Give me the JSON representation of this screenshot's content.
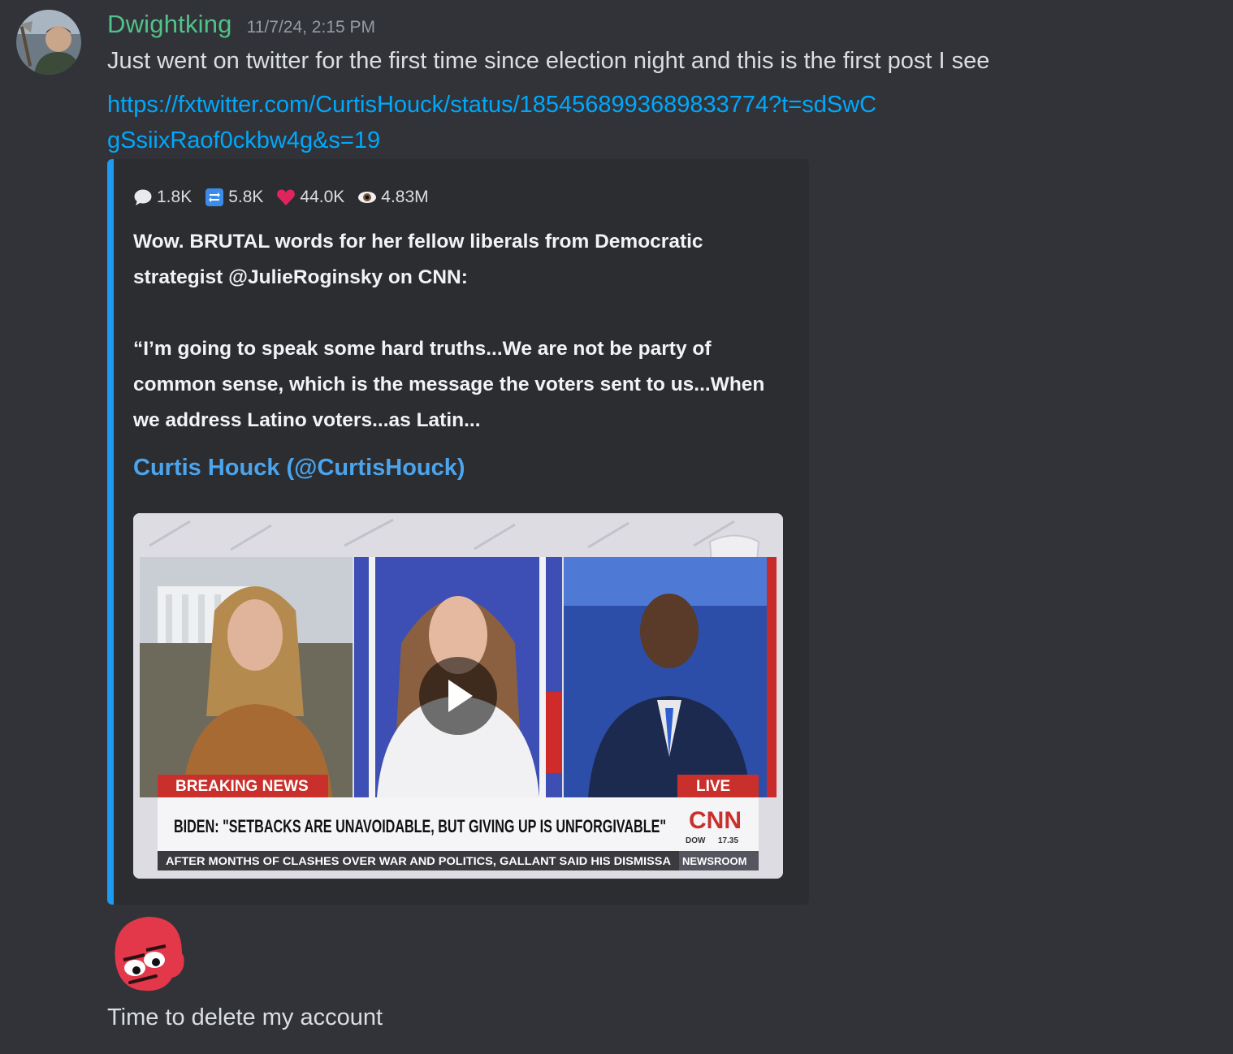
{
  "message": {
    "username": "Dwightking",
    "timestamp": "11/7/24, 2:15 PM",
    "text": "Just went on twitter for the first time since election night and this is the first post I see",
    "link": "https://fxtwitter.com/CurtisHouck/status/1854568993689833774?t=sdSwCgSsiixRaof0ckbw4g&s=19",
    "followup_text": "Time to delete my account"
  },
  "embed": {
    "accent_color": "#1d9bf0",
    "stats": {
      "replies": "1.8K",
      "retweets": "5.8K",
      "likes": "44.0K",
      "views": "4.83M"
    },
    "tweet_paragraph_1": "Wow. BRUTAL words for her fellow liberals from Democratic strategist @JulieRoginsky on CNN:",
    "tweet_paragraph_2": "“I’m going to speak some hard truths...We are not be party of common sense, which is the message the voters sent to us...When we address Latino voters...as Latin...",
    "author": "Curtis Houck (@CurtisHouck)",
    "video": {
      "breaking_label": "BREAKING NEWS",
      "live_label": "LIVE",
      "headline": "BIDEN: \"SETBACKS ARE UNAVOIDABLE, BUT GIVING UP IS UNFORGIVABLE\"",
      "network": "CNN",
      "ticker_index": "DOW",
      "ticker_value": "17.35",
      "crawl": "AFTER MONTHS OF CLASHES OVER WAR AND POLITICS, GALLANT SAID HIS DISMISSA",
      "crawl_tag": "NEWSROOM"
    }
  },
  "icons": [
    "speech-bubble-icon",
    "retweet-icon",
    "heart-icon",
    "eye-icon",
    "play-icon"
  ]
}
